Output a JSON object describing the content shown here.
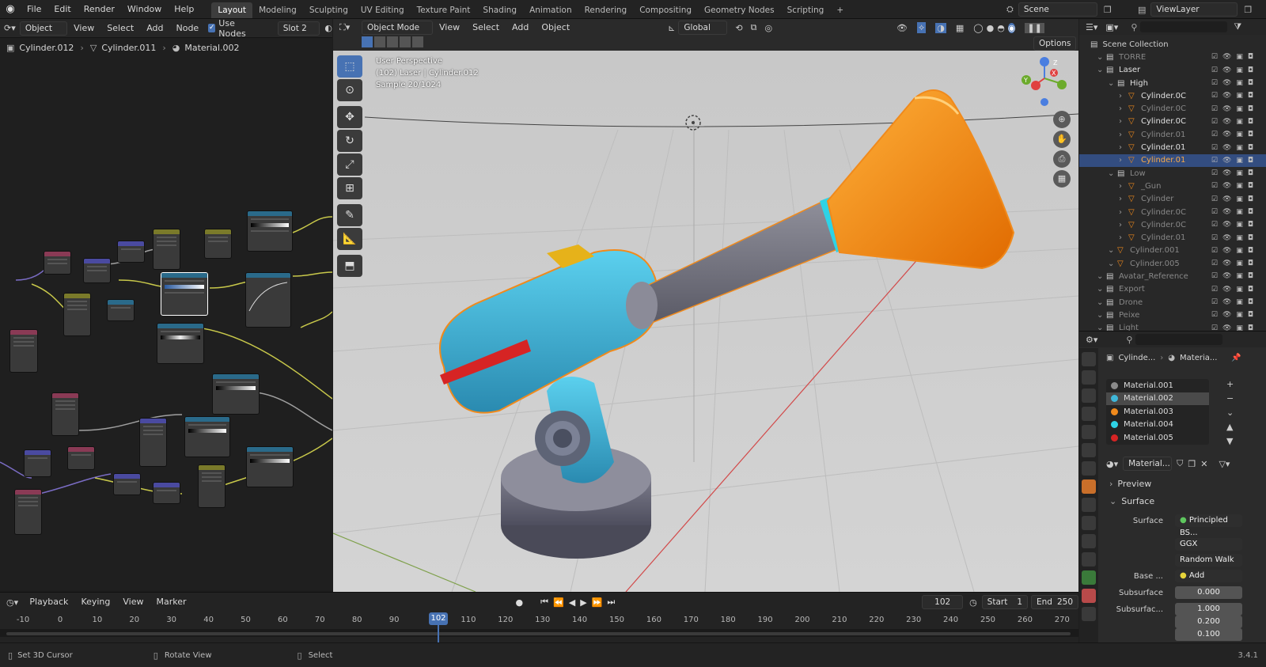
{
  "topbar": {
    "menus": [
      "File",
      "Edit",
      "Render",
      "Window",
      "Help"
    ],
    "workspaces": [
      "Layout",
      "Modeling",
      "Sculpting",
      "UV Editing",
      "Texture Paint",
      "Shading",
      "Animation",
      "Rendering",
      "Compositing",
      "Geometry Nodes",
      "Scripting"
    ],
    "active_workspace": "Layout",
    "add_tab": "+",
    "scene": "Scene",
    "view_layer": "ViewLayer"
  },
  "node_editor": {
    "mode": "Object",
    "menus": [
      "View",
      "Select",
      "Add",
      "Node"
    ],
    "use_nodes_label": "Use Nodes",
    "slot": "Slot 2",
    "breadcrumb": [
      "Cylinder.012",
      "Cylinder.011",
      "Material.002"
    ]
  },
  "viewport": {
    "mode": "Object Mode",
    "menus": [
      "View",
      "Select",
      "Add",
      "Object"
    ],
    "transform_orientation": "Global",
    "options_label": "Options",
    "overlay_lines": [
      "User Perspective",
      "(102) Laser | Cylinder.012",
      "Sample 20/1024"
    ],
    "gizmo_axes": [
      "X",
      "Y",
      "Z"
    ]
  },
  "outliner": {
    "title": "Scene Collection",
    "rows": [
      {
        "label": "TORRE",
        "indent": 1,
        "dim": true
      },
      {
        "label": "Laser",
        "indent": 1,
        "dim": false
      },
      {
        "label": "High",
        "indent": 2,
        "dim": false
      },
      {
        "label": "Cylinder.0C",
        "indent": 3,
        "dim": false
      },
      {
        "label": "Cylinder.0C",
        "indent": 3,
        "dim": true
      },
      {
        "label": "Cylinder.0C",
        "indent": 3,
        "dim": false
      },
      {
        "label": "Cylinder.01",
        "indent": 3,
        "dim": true
      },
      {
        "label": "Cylinder.01",
        "indent": 3,
        "dim": false
      },
      {
        "label": "Cylinder.01",
        "indent": 3,
        "dim": false,
        "selected": true
      },
      {
        "label": "Low",
        "indent": 2,
        "dim": true
      },
      {
        "label": "_Gun",
        "indent": 3,
        "dim": true
      },
      {
        "label": "Cylinder",
        "indent": 3,
        "dim": true
      },
      {
        "label": "Cylinder.0C",
        "indent": 3,
        "dim": true
      },
      {
        "label": "Cylinder.0C",
        "indent": 3,
        "dim": true
      },
      {
        "label": "Cylinder.01",
        "indent": 3,
        "dim": true
      },
      {
        "label": "Cylinder.001",
        "indent": 2,
        "dim": true
      },
      {
        "label": "Cylinder.005",
        "indent": 2,
        "dim": true
      },
      {
        "label": "Avatar_Reference",
        "indent": 1,
        "dim": true
      },
      {
        "label": "Export",
        "indent": 1,
        "dim": true
      },
      {
        "label": "Drone",
        "indent": 1,
        "dim": true
      },
      {
        "label": "Peixe",
        "indent": 1,
        "dim": true
      },
      {
        "label": "Light",
        "indent": 1,
        "dim": true
      }
    ]
  },
  "properties": {
    "breadcrumb": [
      "Cylinde...",
      "Materia..."
    ],
    "materials": [
      {
        "name": "Material.001",
        "color": "#8a8a8a"
      },
      {
        "name": "Material.002",
        "color": "#3fb7d9",
        "selected": true
      },
      {
        "name": "Material.003",
        "color": "#f08a1c"
      },
      {
        "name": "Material.004",
        "color": "#2ed3e6"
      },
      {
        "name": "Material.005",
        "color": "#d62424"
      }
    ],
    "material_field": "Material...",
    "panels": {
      "preview": "Preview",
      "surface": "Surface",
      "surface_label": "Surface",
      "surface_value": "Principled BS...",
      "distribution": "GGX",
      "subsurface_method": "Random Walk",
      "base_label": "Base ...",
      "base_value": "Add",
      "subsurface_label": "Subsurface",
      "subsurface_value": "0.000",
      "subsurface_radius_label": "Subsurfac...",
      "subsurface_radius": [
        "1.000",
        "0.200",
        "0.100"
      ]
    }
  },
  "timeline": {
    "menus": [
      "Playback",
      "Keying",
      "View",
      "Marker"
    ],
    "current_frame": "102",
    "start_label": "Start",
    "start": "1",
    "end_label": "End",
    "end": "250",
    "ticks": [
      "-10",
      "0",
      "10",
      "20",
      "30",
      "40",
      "50",
      "60",
      "70",
      "80",
      "90",
      "110",
      "120",
      "130",
      "140",
      "150",
      "160",
      "170",
      "180",
      "190",
      "200",
      "210",
      "220",
      "230",
      "240",
      "250",
      "260",
      "270"
    ]
  },
  "statusbar": {
    "items": [
      "Set 3D Cursor",
      "Rotate View",
      "Select"
    ],
    "version": "3.4.1"
  },
  "colors": {
    "accent": "#4772b3",
    "orange": "#f08a1c",
    "cyan": "#3fb7d9"
  }
}
